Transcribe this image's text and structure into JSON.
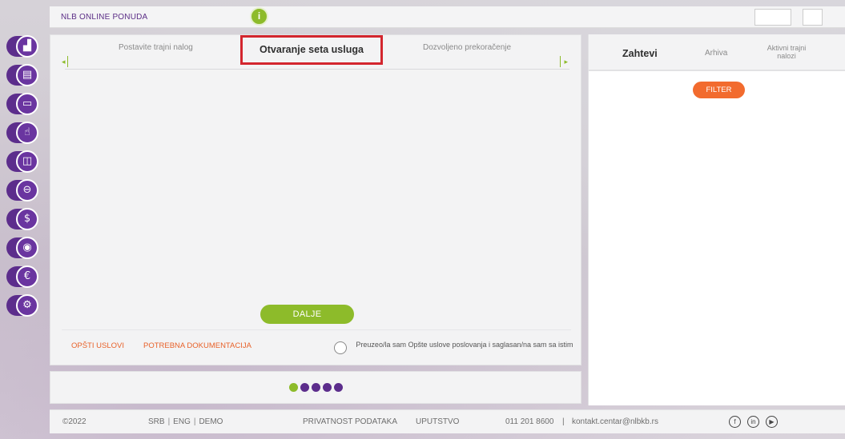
{
  "header": {
    "title": "NLB ONLINE PONUDA",
    "info_icon_glyph": "i"
  },
  "rail": {
    "items": [
      {
        "name": "chart-icon",
        "glyph": "▟"
      },
      {
        "name": "printer-icon",
        "glyph": "▤"
      },
      {
        "name": "card-icon",
        "glyph": "▭"
      },
      {
        "name": "hand-icon",
        "glyph": "☝"
      },
      {
        "name": "devices-icon",
        "glyph": "◫"
      },
      {
        "name": "minus-card-icon",
        "glyph": "⊖"
      },
      {
        "name": "coin-icon",
        "glyph": "$"
      },
      {
        "name": "location-icon",
        "glyph": "◉"
      },
      {
        "name": "euro-icon",
        "glyph": "€"
      },
      {
        "name": "settings-icon",
        "glyph": "⚙"
      }
    ],
    "color": "#6a35a0"
  },
  "main": {
    "tabs": [
      {
        "label": "Postavite trajni nalog"
      },
      {
        "label": "Otvaranje seta usluga"
      },
      {
        "label": "Dozvoljeno prekoračenje"
      }
    ],
    "arrow_left": "◂",
    "arrow_right": "▸",
    "next_button": "DALJE",
    "links": {
      "terms": "OPŠTI USLOVI",
      "documents": "POTREBNA DOKUMENTACIJA"
    },
    "agreement": "Preuzeo/la sam Opšte uslove poslovanja i saglasan/na sam sa istim"
  },
  "pager": {
    "steps": 5,
    "current_step": 1
  },
  "right": {
    "tabs": [
      {
        "label": "Zahtevi"
      },
      {
        "label": "Arhiva"
      },
      {
        "label": "Aktivni trajni nalozi"
      }
    ],
    "filter_button": "FILTER"
  },
  "footer": {
    "copyright": "©2022",
    "languages": [
      "SRB",
      "ENG",
      "DEMO"
    ],
    "privacy": "PRIVATNOST PODATAKA",
    "guide": "UPUTSTVO",
    "phone": "011 201 8600",
    "email": "kontakt.centar@nlbkb.rs",
    "social": [
      {
        "name": "facebook-icon",
        "glyph": "f"
      },
      {
        "name": "linkedin-icon",
        "glyph": "in"
      },
      {
        "name": "youtube-icon",
        "glyph": "▶"
      }
    ]
  },
  "colors": {
    "brand_purple": "#5c2d8c",
    "accent_green": "#8dbb2a",
    "accent_orange": "#f26b2e",
    "highlight_red": "#d3262e"
  }
}
